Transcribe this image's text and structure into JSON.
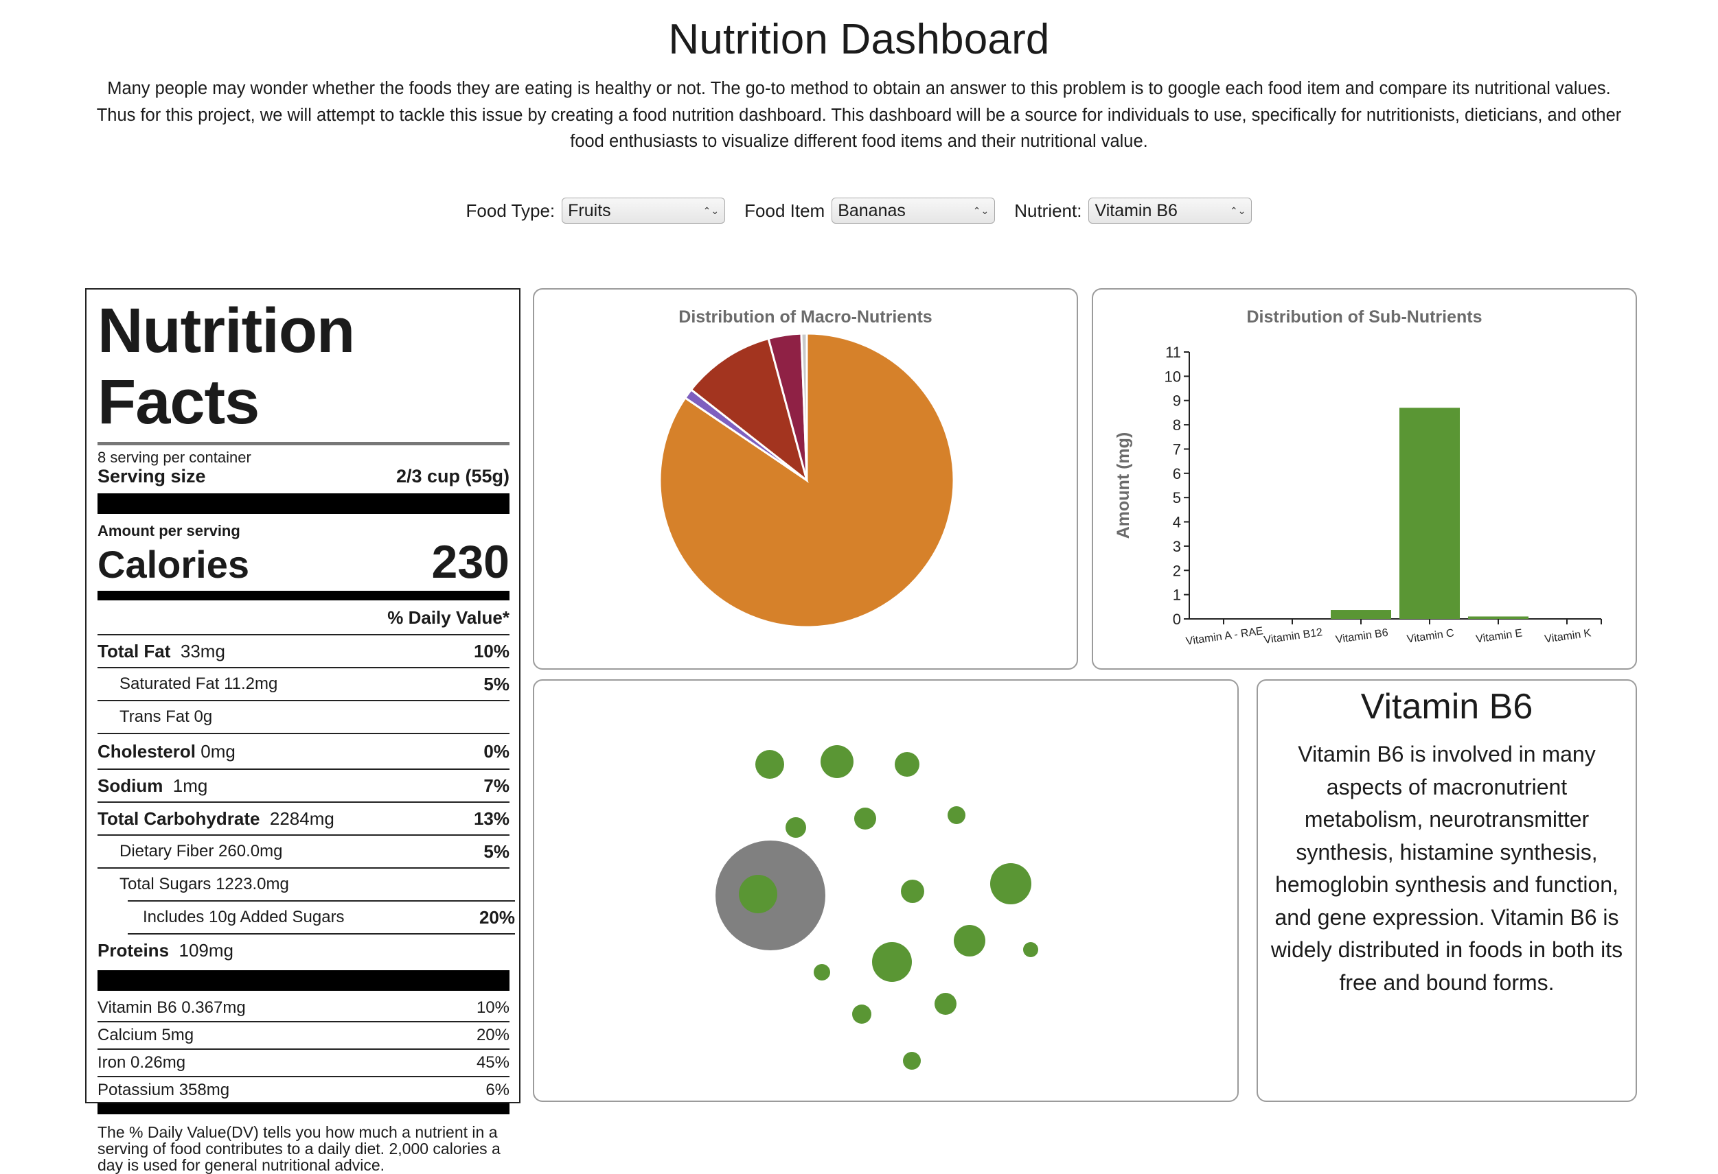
{
  "page": {
    "title": "Nutrition Dashboard",
    "intro": "Many people may wonder whether the foods they are eating is healthy or not. The go-to method to obtain an answer to this problem is to google each food item and compare its nutritional values. Thus for this project, we will attempt to tackle this issue by creating a food nutrition dashboard. This dashboard will be a source for individuals to use, specifically for nutritionists, dieticians, and other food enthusiasts to visualize different food items and their nutritional value."
  },
  "controls": {
    "food_type_label": "Food Type:",
    "food_type_value": "Fruits",
    "food_item_label": "Food Item",
    "food_item_value": "Bananas",
    "nutrient_label": "Nutrient:",
    "nutrient_value": "Vitamin B6"
  },
  "nutrition_facts": {
    "title": "Nutrition Facts",
    "servings": "8 serving per container",
    "serving_size_label": "Serving size",
    "serving_size_value": "2/3 cup (55g)",
    "amount_per_serving": "Amount per serving",
    "calories_label": "Calories",
    "calories_value": "230",
    "dv_header": "% Daily Value*",
    "rows": [
      {
        "label": "Total Fat",
        "value": "33mg",
        "pct": "10%"
      },
      {
        "label": "Saturated Fat 11.2mg",
        "value": "",
        "pct": "5%"
      },
      {
        "label": "Trans Fat 0g",
        "value": "",
        "pct": ""
      },
      {
        "label": "Cholesterol",
        "value": "0mg",
        "pct": "0%"
      },
      {
        "label": "Sodium",
        "value": "1mg",
        "pct": "7%"
      },
      {
        "label": "Total Carbohydrate",
        "value": "2284mg",
        "pct": "13%"
      },
      {
        "label": "Dietary Fiber 260.0mg",
        "value": "",
        "pct": "5%"
      },
      {
        "label": "Total Sugars 1223.0mg",
        "value": "",
        "pct": ""
      },
      {
        "label": "Includes 10g Added Sugars",
        "value": "",
        "pct": "20%"
      },
      {
        "label": "Proteins",
        "value": "109mg",
        "pct": ""
      }
    ],
    "vitamins": [
      {
        "label": "Vitamin B6 0.367mg",
        "pct": "10%"
      },
      {
        "label": "Calcium 5mg",
        "pct": "20%"
      },
      {
        "label": "Iron 0.26mg",
        "pct": "45%"
      },
      {
        "label": "Potassium 358mg",
        "pct": "6%"
      }
    ],
    "footnote": "The % Daily Value(DV) tells you how much a nutrient in a serving of food contributes to a daily diet. 2,000 calories a day is used for general nutritional advice."
  },
  "colors": {
    "pie": [
      "#d6812a",
      "#7e5fbf",
      "#a3341f",
      "#8f2145",
      "#c9c9c9"
    ],
    "bar": "#5a9634",
    "bubble": "#5a9634",
    "center_bubble": "#808080"
  },
  "chart_data": [
    {
      "type": "pie",
      "title": "Distribution of Macro-Nutrients",
      "values": [
        84.4,
        1.1,
        10.2,
        3.6,
        0.6
      ]
    },
    {
      "type": "bar",
      "title": "Distribution of Sub-Nutrients",
      "ylabel": "Amount (mg)",
      "ylim": [
        0,
        11
      ],
      "yticks": [
        0,
        1,
        2,
        3,
        4,
        5,
        6,
        7,
        8,
        9,
        10,
        11
      ],
      "categories": [
        "Vitamin A - RAE",
        "Vitamin B12",
        "Vitamin B6",
        "Vitamin C",
        "Vitamin E",
        "Vitamin K"
      ],
      "values": [
        0.0,
        0.0,
        0.367,
        8.7,
        0.1,
        0.0
      ]
    }
  ],
  "nutrient_info": {
    "title": "Vitamin B6",
    "body": "Vitamin B6 is involved in many aspects of macronutrient metabolism, neurotransmitter synthesis, histamine synthesis, hemoglobin synthesis and function, and gene expression. Vitamin B6 is widely distributed in foods in both its free and bound forms."
  }
}
